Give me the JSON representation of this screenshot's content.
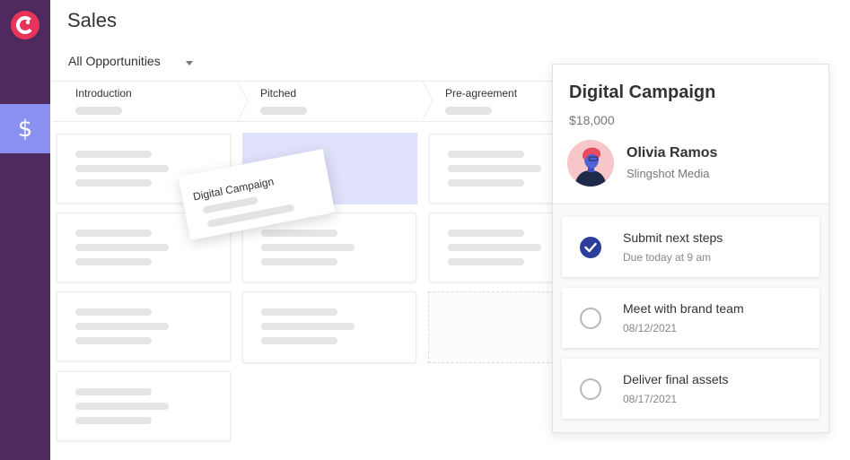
{
  "app": {
    "brand_color": "#e8335a",
    "sidebar_color": "#4e2a5e",
    "active_nav_color": "#8a90f0",
    "accent_color": "#2c3e9a",
    "nav": [
      {
        "icon": "logo-icon",
        "active": false
      },
      {
        "icon": "dollar-icon",
        "label": "$",
        "active": true
      }
    ]
  },
  "header": {
    "title": "Sales",
    "filter_label": "All Opportunities",
    "filter_icon": "chevron-down-icon"
  },
  "pipeline": {
    "stages": [
      {
        "label": "Introduction"
      },
      {
        "label": "Pitched"
      },
      {
        "label": "Pre-agreement"
      }
    ],
    "dragging_card": {
      "title": "Digital Campaign"
    }
  },
  "detail": {
    "title": "Digital Campaign",
    "amount": "$18,000",
    "contact": {
      "name": "Olivia Ramos",
      "company": "Slingshot Media"
    },
    "tasks": [
      {
        "title": "Submit next steps",
        "due": "Due today at 9 am",
        "completed": true
      },
      {
        "title": "Meet with brand team",
        "due": "08/12/2021",
        "completed": false
      },
      {
        "title": "Deliver final assets",
        "due": "08/17/2021",
        "completed": false
      }
    ]
  }
}
